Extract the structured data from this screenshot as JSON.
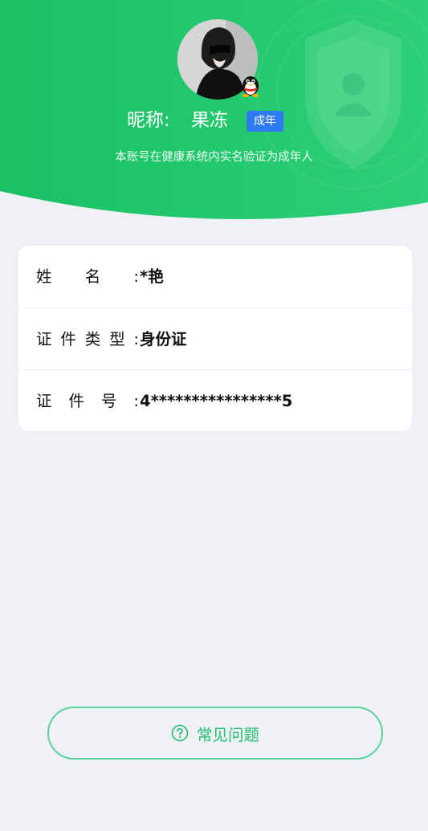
{
  "profile": {
    "nickname_label": "昵称:",
    "nickname_value": "果冻",
    "age_badge": "成年",
    "verify_note": "本账号在健康系统内实名验证为成年人"
  },
  "info": {
    "rows": [
      {
        "label": "姓名:",
        "value": "*艳"
      },
      {
        "label": "证件类型:",
        "value": "身份证"
      },
      {
        "label": "证件号:",
        "value": "4****************5"
      }
    ]
  },
  "faq": {
    "label": "常见问题",
    "icon": "question-circle-icon"
  },
  "colors": {
    "header_green": "#1fc467",
    "page_bg": "#eff1f6",
    "badge_blue": "#2f7bf5",
    "faq_green": "#22bd6c"
  }
}
